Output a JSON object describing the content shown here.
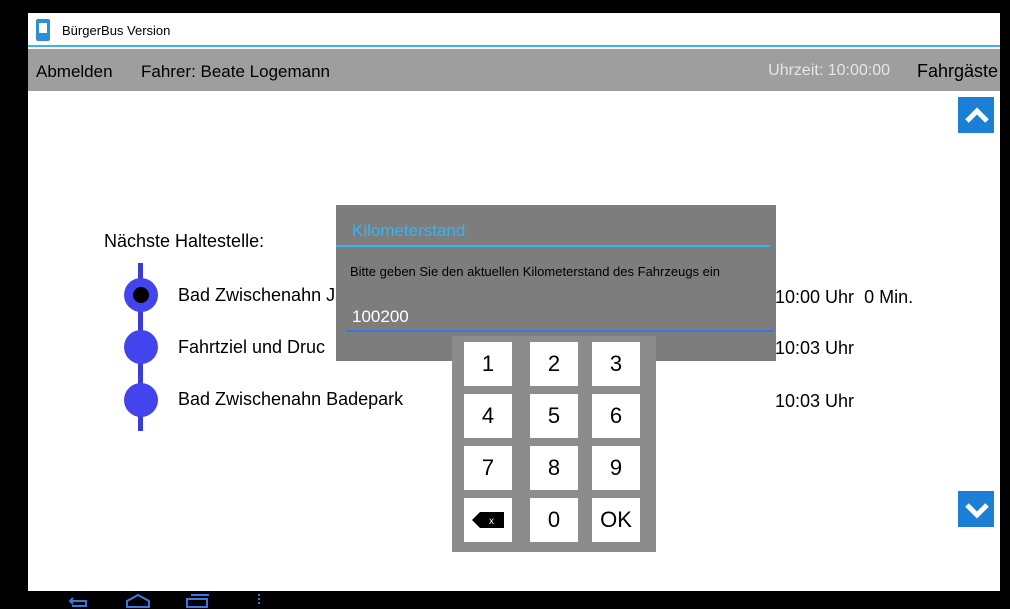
{
  "window": {
    "title": "BürgerBus Version"
  },
  "header": {
    "logout_label": "Abmelden",
    "driver_label": "Fahrer: Beate Logemann",
    "time_label": "Uhrzeit: 10:00:00",
    "passengers_label": "Fahrgäste"
  },
  "main": {
    "next_stop_label": "Nächste Haltestelle:",
    "stops": [
      {
        "name": "Bad Zwischenahn J",
        "time": "10:00 Uhr",
        "delay": "0 Min.",
        "current": true
      },
      {
        "name": "Fahrtziel und Druc",
        "time": "10:03 Uhr",
        "delay": "",
        "current": false
      },
      {
        "name": "Bad Zwischenahn Badepark",
        "time": "10:03 Uhr",
        "delay": "",
        "current": false
      }
    ]
  },
  "dialog": {
    "title": "Kilometerstand",
    "message": "Bitte geben Sie den aktuellen Kilometerstand des Fahrzeugs ein",
    "value": "100200"
  },
  "keypad": {
    "keys": [
      "1",
      "2",
      "3",
      "4",
      "5",
      "6",
      "7",
      "8",
      "9",
      "backspace-icon",
      "0",
      "OK"
    ]
  },
  "colors": {
    "accent": "#35b4f0",
    "route": "#4444ee",
    "arrow_button": "#1c7fd6",
    "header_bg": "#9e9e9e",
    "dialog_bg": "#7d7d7d"
  }
}
